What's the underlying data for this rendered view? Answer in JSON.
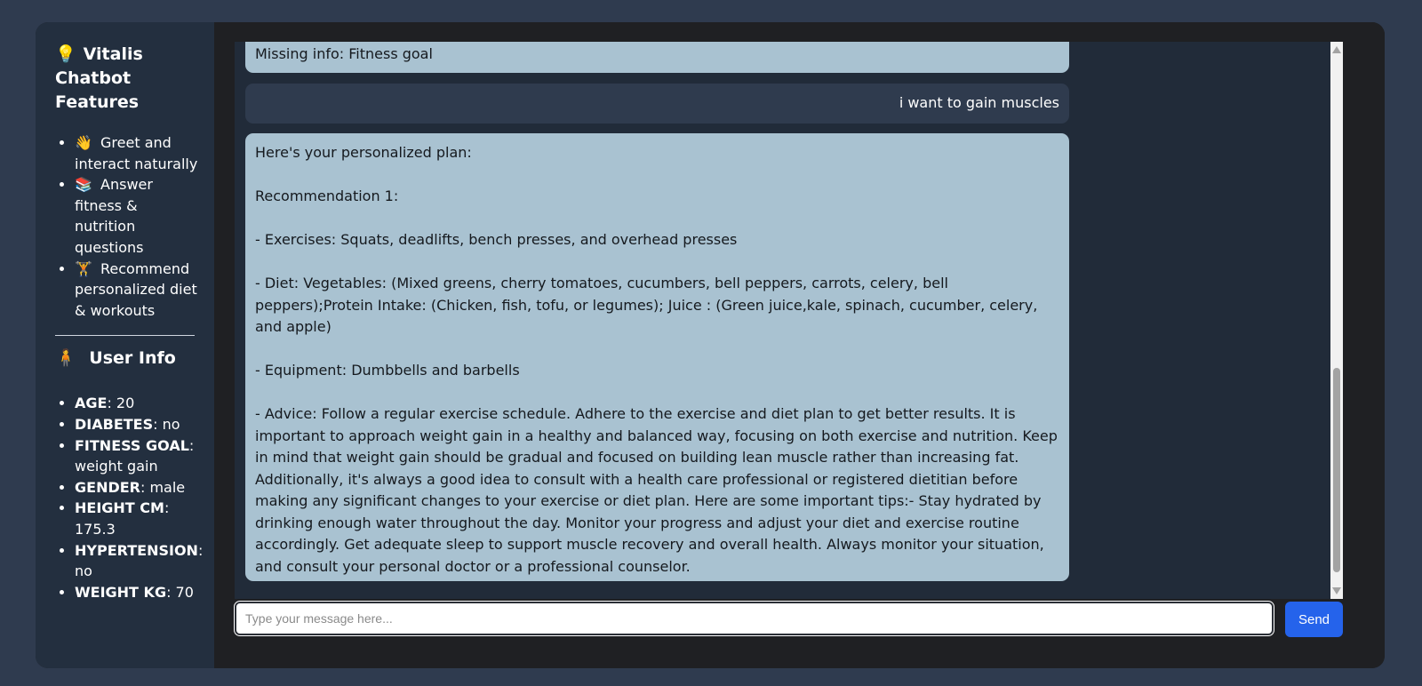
{
  "sidebar": {
    "title_icon": "💡",
    "title": "Vitalis Chatbot Features",
    "features": [
      {
        "icon": "👋",
        "icon_name": "waving-hand-icon",
        "label": "Greet and interact naturally"
      },
      {
        "icon": "📚",
        "icon_name": "books-icon",
        "label": "Answer fitness & nutrition questions"
      },
      {
        "icon": "🏋️",
        "icon_name": "weightlifter-icon",
        "label": "Recommend personalized diet & workouts"
      }
    ],
    "user_info_icon": "🧍",
    "user_info_title": "User Info",
    "user_info": [
      {
        "key": "AGE",
        "value": ": 20"
      },
      {
        "key": "DIABETES",
        "value": ": no"
      },
      {
        "key": "FITNESS GOAL",
        "value": ": weight gain"
      },
      {
        "key": "GENDER",
        "value": ": male"
      },
      {
        "key": "HEIGHT CM",
        "value": ": 175.3"
      },
      {
        "key": "HYPERTENSION",
        "value": ": no"
      },
      {
        "key": "WEIGHT KG",
        "value": ": 70"
      }
    ]
  },
  "chat": {
    "messages": [
      {
        "role": "bot",
        "text": "Missing info: Fitness goal"
      },
      {
        "role": "user",
        "text": "i want to gain muscles"
      },
      {
        "role": "bot",
        "paragraphs": [
          "Here's your personalized plan:",
          "Recommendation 1:",
          "- Exercises: Squats, deadlifts, bench presses, and overhead presses",
          "- Diet: Vegetables: (Mixed greens, cherry tomatoes, cucumbers, bell peppers, carrots, celery, bell peppers);Protein Intake: (Chicken, fish, tofu, or legumes); Juice : (Green juice,kale, spinach, cucumber, celery, and apple)",
          "- Equipment: Dumbbells and barbells",
          "- Advice: Follow a regular exercise schedule. Adhere to the exercise and diet plan to get better results. It is important to approach weight gain in a healthy and balanced way, focusing on both exercise and nutrition. Keep in mind that weight gain should be gradual and focused on building lean muscle rather than increasing fat. Additionally, it's always a good idea to consult with a health care professional or registered dietitian before making any significant changes to your exercise or diet plan. Here are some important tips:- Stay hydrated by drinking enough water throughout the day. Monitor your progress and adjust your diet and exercise routine accordingly. Get adequate sleep to support muscle recovery and overall health. Always monitor your situation, and consult your personal doctor or a professional counselor."
        ]
      }
    ]
  },
  "composer": {
    "placeholder": "Type your message here...",
    "send_label": "Send"
  },
  "colors": {
    "page_bg": "#2f3b4f",
    "sidebar_bg": "#232f3f",
    "bot_bubble": "#a9c2d1",
    "user_bubble": "#2f3b4e",
    "send_button": "#2563eb"
  }
}
